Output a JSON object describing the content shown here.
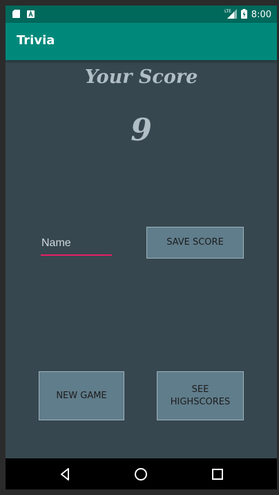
{
  "status_bar": {
    "time": "8:00",
    "network": "LTE",
    "icons": [
      "sd-card-icon",
      "a-notification-icon",
      "signal-icon",
      "battery-charging-icon"
    ]
  },
  "app_bar": {
    "title": "Trivia"
  },
  "score": {
    "heading": "Your Score",
    "value": "9"
  },
  "name_input": {
    "placeholder": "Name",
    "value": ""
  },
  "buttons": {
    "save_score": "SAVE SCORE",
    "new_game": "NEW GAME",
    "see_highscores": "SEE\nHIGHSCORES"
  },
  "nav_bar": {
    "icons": [
      "back-icon",
      "home-icon",
      "recents-icon"
    ]
  },
  "colors": {
    "status_bar": "#00695c",
    "app_bar": "#00897b",
    "background": "#37474f",
    "button": "#607d8b",
    "input_underline": "#e91e63"
  }
}
